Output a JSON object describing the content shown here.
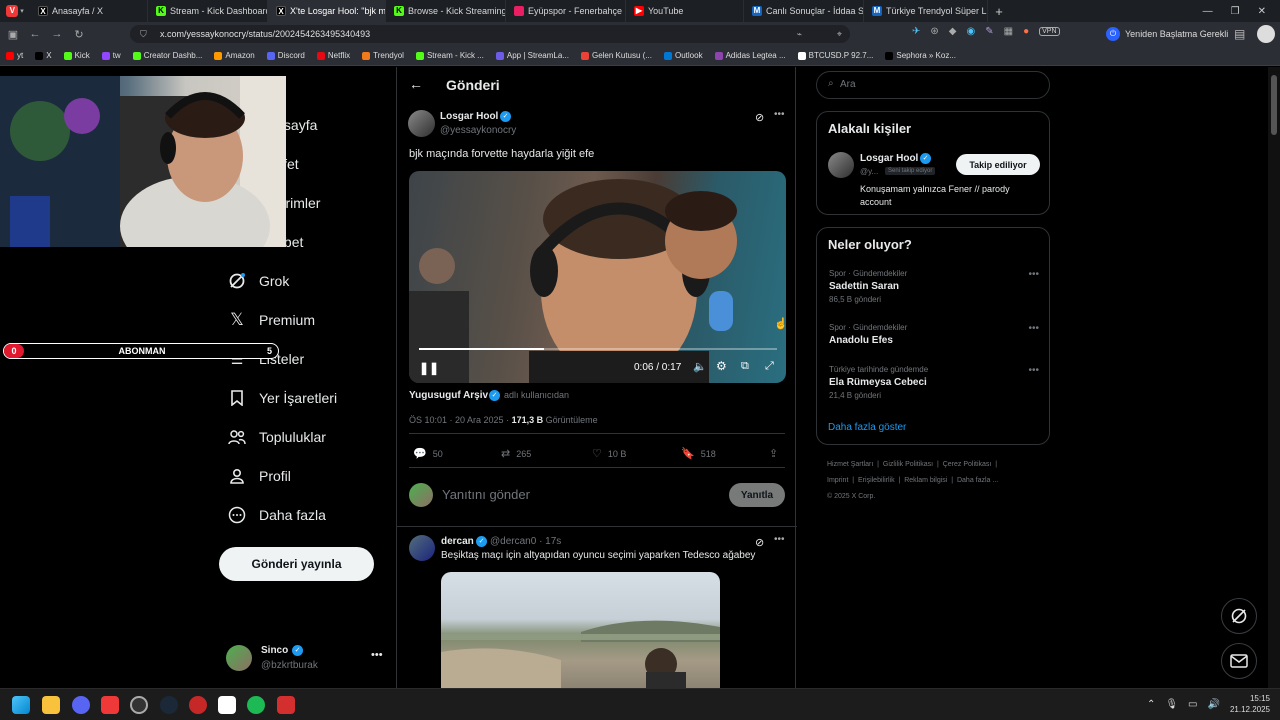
{
  "browser": {
    "tabs": [
      {
        "title": "Anasayfa / X",
        "icon": "x-icon",
        "color": "#000000",
        "active": false
      },
      {
        "title": "Stream - Kick Dashboard",
        "icon": "kick-icon",
        "color": "#53fc18",
        "active": false
      },
      {
        "title": "X'te Losgar Hool: \"bjk maç",
        "icon": "x-icon",
        "color": "#000000",
        "active": true
      },
      {
        "title": "Browse - Kick Streaming",
        "icon": "kick-icon",
        "color": "#53fc18",
        "active": false
      },
      {
        "title": "Eyüpspor - Fenerbahçe Ma",
        "icon": "sports-icon",
        "color": "#e91e63",
        "active": false
      },
      {
        "title": "YouTube",
        "icon": "youtube-icon",
        "color": "#ff0000",
        "active": false
      },
      {
        "title": "Canlı Sonuçlar - İddaa Sonu",
        "icon": "m-icon",
        "color": "#1565c0",
        "active": false
      },
      {
        "title": "Türkiye Trendyol Süper Lig",
        "icon": "m-icon",
        "color": "#1565c0",
        "active": false
      }
    ],
    "new_tab": "+",
    "url": "x.com/yessaykonocry/status/2002454263495340493",
    "restart_label": "Yeniden Başlatma Gerekli",
    "vpn_label": "VPN",
    "bookmarks": [
      {
        "label": "yt",
        "color": "#ff0000"
      },
      {
        "label": "X",
        "color": "#000000"
      },
      {
        "label": "Kick",
        "color": "#53fc18"
      },
      {
        "label": "tw",
        "color": "#9146ff"
      },
      {
        "label": "Creator Dashb...",
        "color": "#53fc18"
      },
      {
        "label": "Amazon",
        "color": "#ff9900"
      },
      {
        "label": "Discord",
        "color": "#5865f2"
      },
      {
        "label": "Netflix",
        "color": "#e50914"
      },
      {
        "label": "Trendyol",
        "color": "#f27a1a"
      },
      {
        "label": "Stream - Kick ...",
        "color": "#53fc18"
      },
      {
        "label": "App | StreamLa...",
        "color": "#6c5ce7"
      },
      {
        "label": "Gelen Kutusu (...",
        "color": "#ea4335"
      },
      {
        "label": "Outlook",
        "color": "#0078d4"
      },
      {
        "label": "Adidas Legtea ...",
        "color": "#8e44ad"
      },
      {
        "label": "BTCUSD.P 92.7...",
        "color": "#ffffff"
      },
      {
        "label": "Sephora » Koz...",
        "color": "#000000"
      }
    ]
  },
  "sidebar": {
    "items": [
      {
        "label": "Anasayfa",
        "icon": "home-icon"
      },
      {
        "label": "Keşfet",
        "icon": "explore-icon"
      },
      {
        "label": "Bildirimler",
        "icon": "bell-icon"
      },
      {
        "label": "Sohbet",
        "icon": "chat-icon"
      },
      {
        "label": "Grok",
        "icon": "grok-icon"
      },
      {
        "label": "Premium",
        "icon": "x-logo-icon"
      },
      {
        "label": "Listeler",
        "icon": "list-icon"
      },
      {
        "label": "Yer İşaretleri",
        "icon": "bookmark-icon"
      },
      {
        "label": "Topluluklar",
        "icon": "communities-icon"
      },
      {
        "label": "Profil",
        "icon": "profile-icon"
      },
      {
        "label": "Daha fazla",
        "icon": "more-circle-icon"
      }
    ],
    "post_button": "Gönderi yayınla",
    "account": {
      "name": "Sinco",
      "handle": "@bzkrtburak"
    }
  },
  "main": {
    "header_title": "Gönderi",
    "tweet": {
      "author_name": "Losgar Hool",
      "author_handle": "@yessaykonocry",
      "text": "bjk maçında forvette haydarla yiğit efe",
      "video_time": "0:06 / 0:17",
      "video_progress": 0.35,
      "source_name": "Yugusuguf Arşiv",
      "source_suffix": "adlı kullanıcıdan",
      "timestamp": "ÖS 10:01 · 20 Ara 2025 · ",
      "views_count": "171,3 B",
      "views_label": "Görüntüleme",
      "replies": "50",
      "reposts": "265",
      "likes": "10 B",
      "bookmarks": "518"
    },
    "reply_placeholder": "Yanıtını gönder",
    "reply_button": "Yanıtla",
    "second_tweet": {
      "author_name": "dercan",
      "author_handle": "@dercan0 · 17s",
      "text": "Beşiktaş maçı için altyapıdan oyuncu seçimi yaparken Tedesco ağabey"
    }
  },
  "right": {
    "search_placeholder": "Ara",
    "related_title": "Alakalı kişiler",
    "related_person": {
      "name": "Losgar Hool",
      "handle": "@y...",
      "follows_you": "Seni takip ediyor",
      "follow_button": "Takip ediliyor",
      "bio": "Konuşamam yalnızca Fener // parody account"
    },
    "trends_title": "Neler oluyor?",
    "trends": [
      {
        "meta": "Spor · Gündemdekiler",
        "name": "Sadettin Saran",
        "count": "86,5 B gönderi"
      },
      {
        "meta": "Spor · Gündemdekiler",
        "name": "Anadolu Efes",
        "count": ""
      },
      {
        "meta": "Türkiye tarihinde gündemde",
        "name": "Ela Rümeysa Cebeci",
        "count": "21,4 B gönderi"
      }
    ],
    "show_more": "Daha fazla göster",
    "footer": [
      "Hizmet Şartları",
      "Gizlilik Politikası",
      "Çerez Politikası",
      "Imprint",
      "Erişilebilirlik",
      "Reklam bilgisi",
      "Daha fazla ...",
      "© 2025 X Corp."
    ]
  },
  "overlay": {
    "sub_count_left": "0",
    "sub_label": "ABONMAN",
    "sub_count_right": "5"
  },
  "taskbar": {
    "time": "15:15",
    "date": "21.12.2025"
  }
}
